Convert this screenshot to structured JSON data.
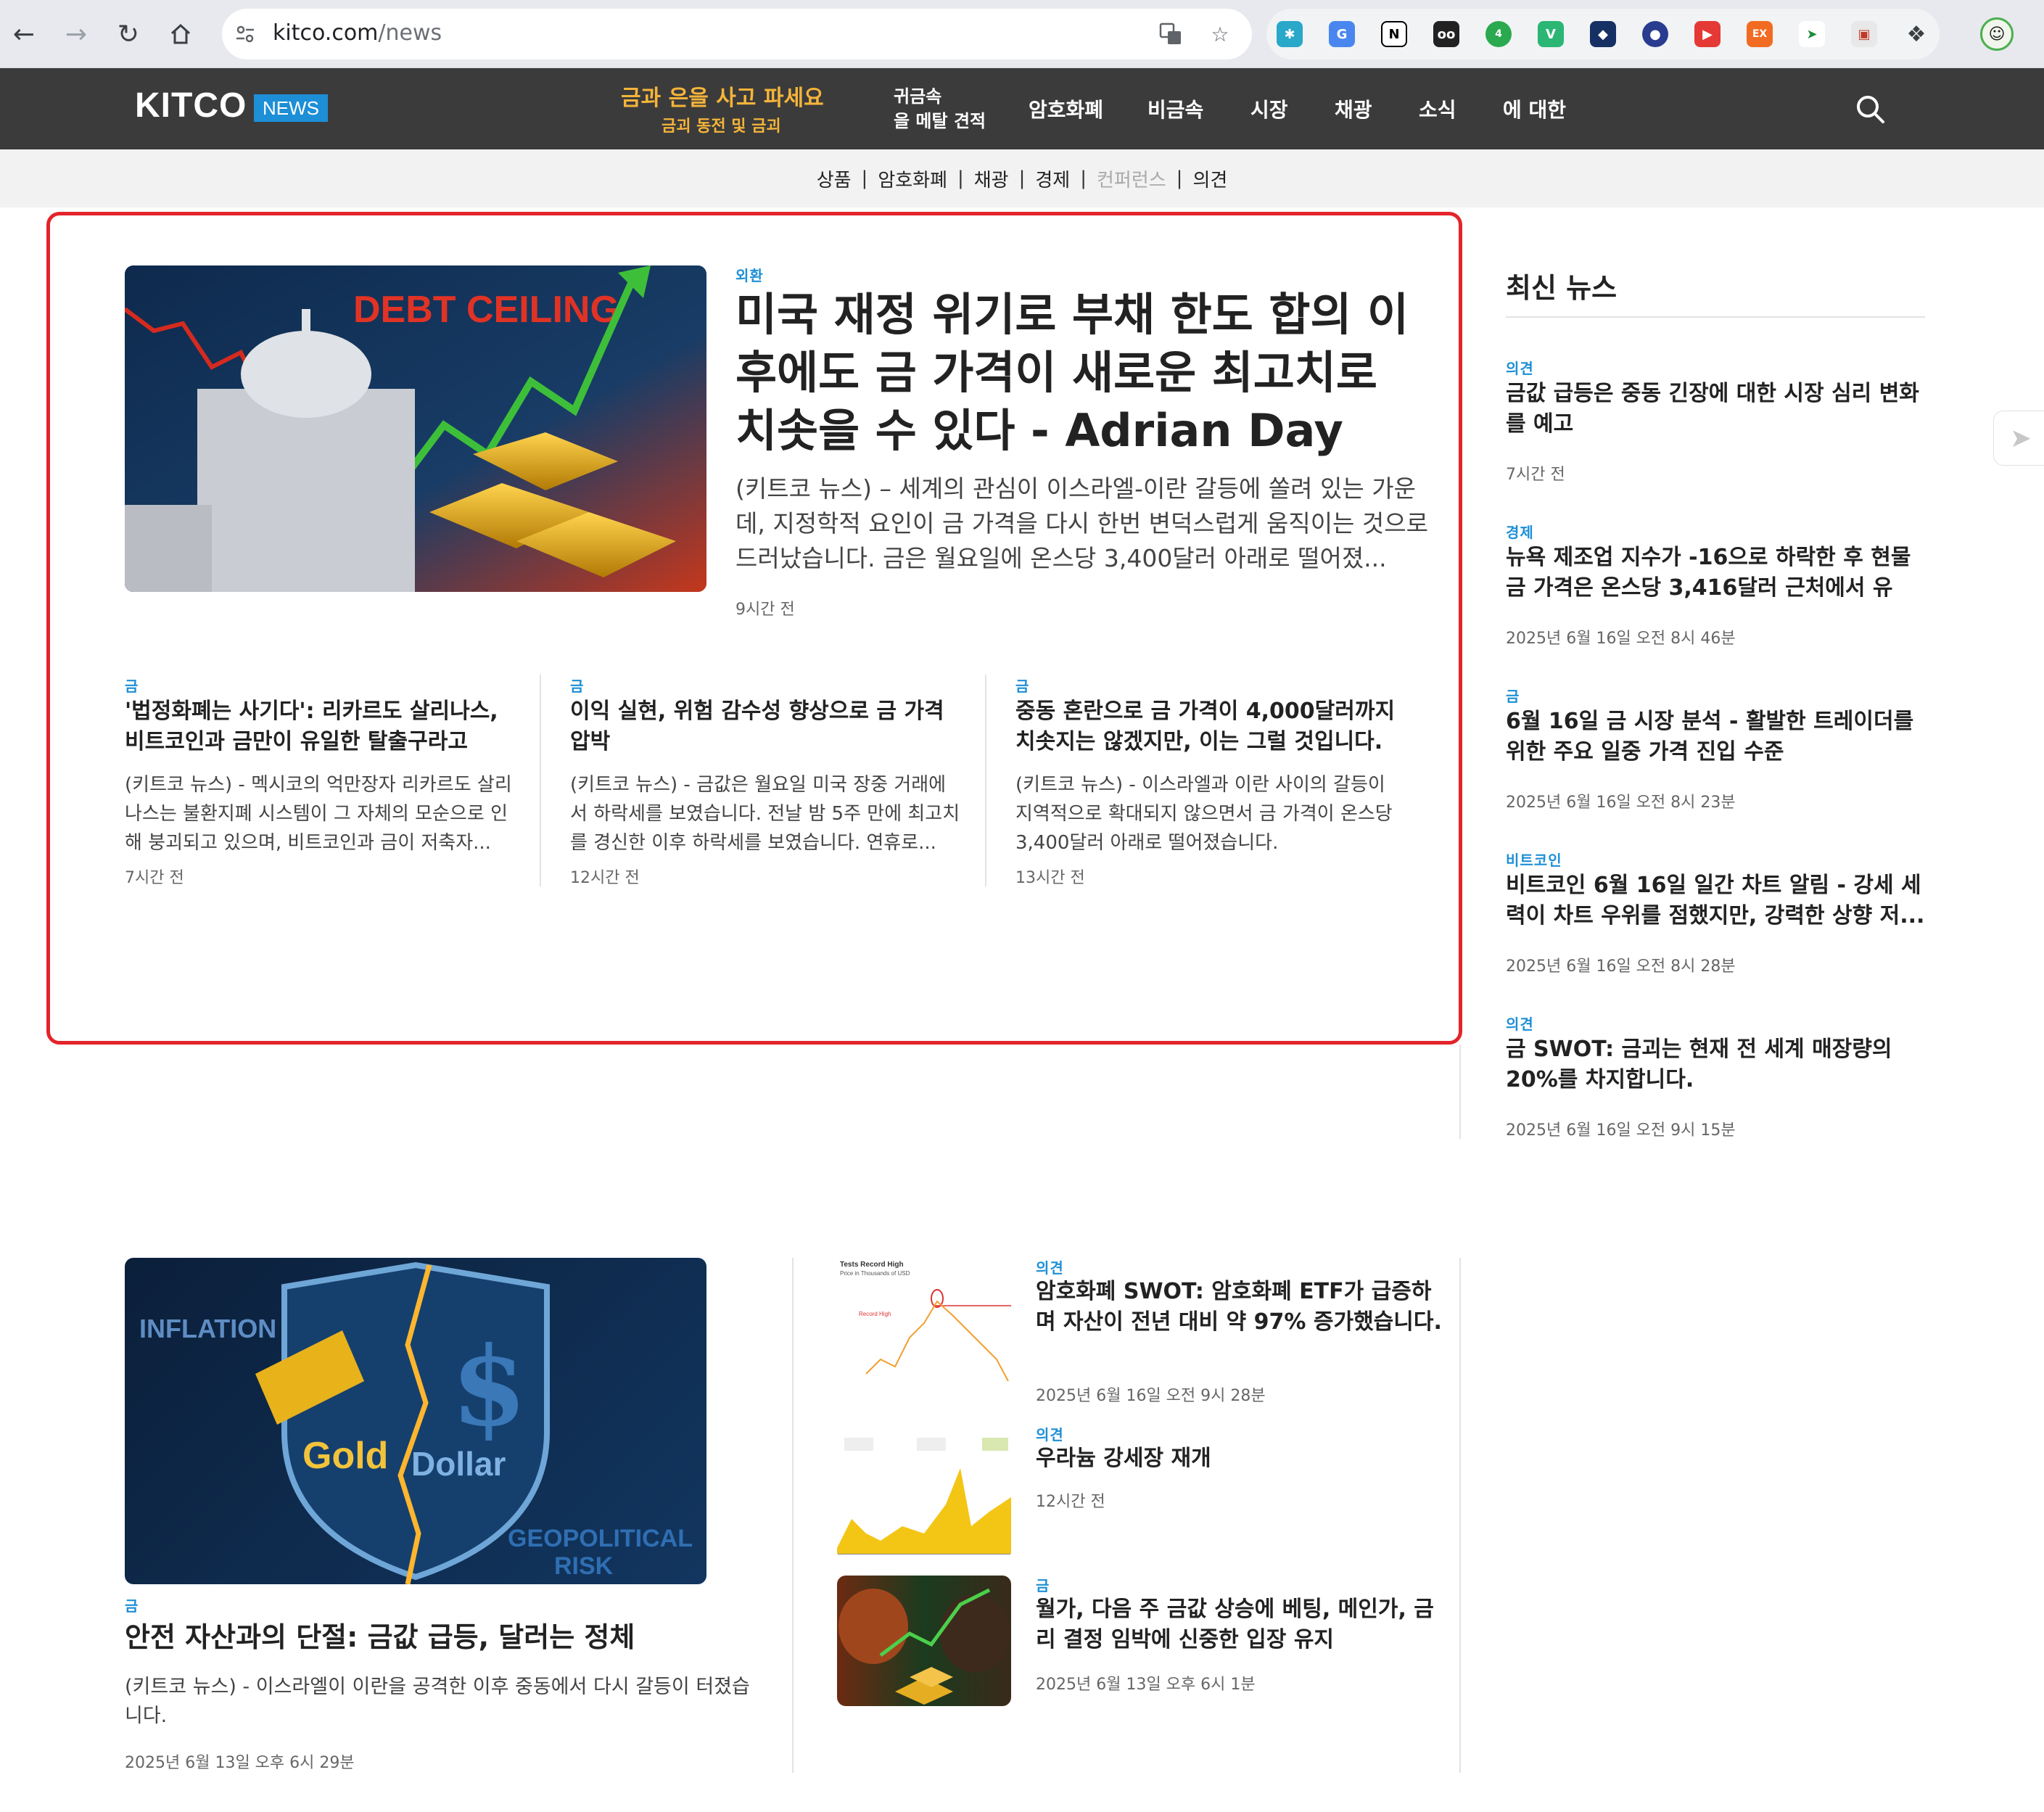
{
  "browser": {
    "url_host": "kitco.com",
    "url_path": "/news",
    "extension_badge": "4"
  },
  "header": {
    "logo": "KITCO",
    "logo_tag": "NEWS",
    "promo_title": "금과 은을 사고 파세요",
    "promo_sub": "금괴 동전 및 금괴",
    "menu_precious": [
      "귀금속",
      "을 메탈 견적"
    ],
    "menu": [
      "암호화폐",
      "비금속",
      "시장",
      "채광",
      "소식",
      "에 대한"
    ]
  },
  "subnav": [
    "상품",
    "암호화폐",
    "채광",
    "경제",
    "컨퍼런스",
    "의견"
  ],
  "featured": {
    "image_text": "DEBT CEILING",
    "category": "외환",
    "title": "미국 재정 위기로 부채 한도 합의 이후에도 금 가격이 새로운 최고치로 치솟을 수 있다 - Adrian Day",
    "lede": "(키트코 뉴스) – 세계의 관심이 이스라엘-이란 갈등에 쏠려 있는 가운데, 지정학적 요인이 금 가격을 다시 한번 변덕스럽게 움직이는 것으로 드러났습니다. 금은 월요일에 온스당 3,400달러 아래로 떨어졌...",
    "time": "9시간 전"
  },
  "sub_articles": [
    {
      "category": "금",
      "title": "'법정화폐는 사기다': 리카르도 살리나스, 비트코인과 금만이 유일한 탈출구라고 주...",
      "snippet": "(키트코 뉴스) - 멕시코의 억만장자 리카르도 살리나스는 불환지폐 시스템이 그 자체의 모순으로 인해 붕괴되고 있으며, 비트코인과 금이 저축자...",
      "time": "7시간 전"
    },
    {
      "category": "금",
      "title": "이익 실현, 위험 감수성 향상으로 금 가격 압박",
      "snippet": "(키트코 뉴스) - 금값은 월요일 미국 장중 거래에서 하락세를 보였습니다. 전날 밤 5주 만에 최고치를 경신한 이후 하락세를 보였습니다. 연휴로...",
      "time": "12시간 전"
    },
    {
      "category": "금",
      "title": "중동 혼란으로 금 가격이 4,000달러까지 치솟지는 않겠지만, 이는 그럴 것입니다.",
      "snippet": "(키트코 뉴스) - 이스라엘과 이란 사이의 갈등이 지역적으로 확대되지 않으면서 금 가격이 온스당 3,400달러 아래로 떨어졌습니다.",
      "time": "13시간 전"
    }
  ],
  "sidebar": {
    "title": "최신 뉴스",
    "items": [
      {
        "category": "의견",
        "title": "금값 급등은 중동 긴장에 대한 시장 심리 변화를 예고",
        "time": "7시간 전"
      },
      {
        "category": "경제",
        "title": "뉴욕 제조업 지수가 -16으로 하락한 후 현물 금 가격은 온스당 3,416달러 근처에서 유지...",
        "time": "2025년 6월 16일 오전 8시 46분"
      },
      {
        "category": "금",
        "title": "6월 16일 금 시장 분석 - 활발한 트레이더를 위한 주요 일중 가격 진입 수준",
        "time": "2025년 6월 16일 오전 8시 23분"
      },
      {
        "category": "비트코인",
        "title": "비트코인 6월 16일 일간 차트 알림 - 강세 세력이 차트 우위를 점했지만, 강력한 상향 저...",
        "time": "2025년 6월 16일 오전 8시 28분"
      },
      {
        "category": "의견",
        "title": "금 SWOT: 금괴는 현재 전 세계 매장량의 20%를 차지합니다.",
        "time": "2025년 6월 16일 오전 9시 15분"
      }
    ]
  },
  "second_featured": {
    "image_labels": [
      "INFLATION",
      "Gold",
      "Dollar",
      "GEOPOLITICAL",
      "RISK"
    ],
    "category": "금",
    "title": "안전 자산과의 단절: 금값 급등, 달러는 정체",
    "lede": "(키트코 뉴스) - 이스라엘이 이란을 공격한 이후 중동에서 다시 갈등이 터졌습니다.",
    "time": "2025년 6월 13일 오후 6시 29분"
  },
  "second_list": [
    {
      "category": "의견",
      "title": "암호화폐 SWOT: 암호화폐 ETF가 급증하며 자산이 전년 대비 약 97% 증가했습니다.",
      "time": "2025년 6월 16일 오전 9시 28분",
      "thumb_text": [
        "Tests Record High",
        "Price in Thousands of USD",
        "Record High"
      ]
    },
    {
      "category": "의견",
      "title": "우라늄 강세장 재개",
      "time": "12시간 전"
    },
    {
      "category": "금",
      "title": "월가, 다음 주 금값 상승에 베팅, 메인가, 금리 결정 임박에 신중한 입장 유지",
      "time": "2025년 6월 13일 오후 6시 1분"
    }
  ]
}
